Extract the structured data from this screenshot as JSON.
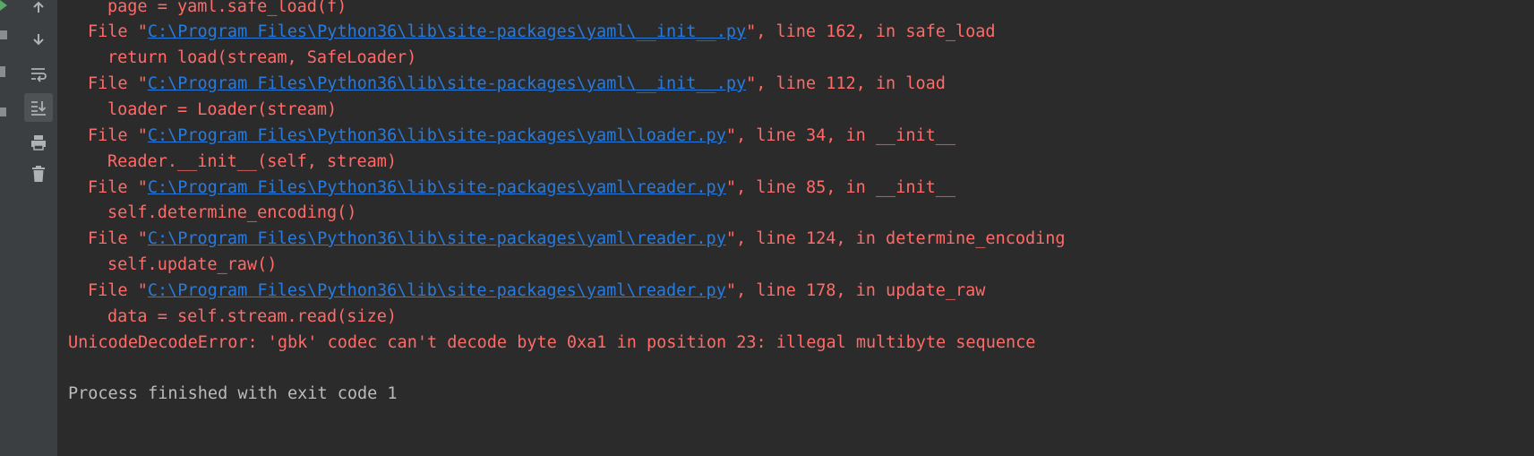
{
  "traceback": {
    "top_code": "page = yaml.safe_load(f)",
    "frames": [
      {
        "prefix": "File \"",
        "path": "C:\\Program Files\\Python36\\lib\\site-packages\\yaml\\__init__.py",
        "suffix": "\", line 162, in safe_load",
        "code": "return load(stream, SafeLoader)"
      },
      {
        "prefix": "File \"",
        "path": "C:\\Program Files\\Python36\\lib\\site-packages\\yaml\\__init__.py",
        "suffix": "\", line 112, in load",
        "code": "loader = Loader(stream)"
      },
      {
        "prefix": "File \"",
        "path": "C:\\Program Files\\Python36\\lib\\site-packages\\yaml\\loader.py",
        "suffix": "\", line 34, in __init__",
        "code": "Reader.__init__(self, stream)"
      },
      {
        "prefix": "File \"",
        "path": "C:\\Program Files\\Python36\\lib\\site-packages\\yaml\\reader.py",
        "suffix": "\", line 85, in __init__",
        "code": "self.determine_encoding()"
      },
      {
        "prefix": "File \"",
        "path": "C:\\Program Files\\Python36\\lib\\site-packages\\yaml\\reader.py",
        "suffix": "\", line 124, in determine_encoding",
        "code": "self.update_raw()"
      },
      {
        "prefix": "File \"",
        "path": "C:\\Program Files\\Python36\\lib\\site-packages\\yaml\\reader.py",
        "suffix": "\", line 178, in update_raw",
        "code": "data = self.stream.read(size)"
      }
    ],
    "error": "UnicodeDecodeError: 'gbk' codec can't decode byte 0xa1 in position 23: illegal multibyte sequence"
  },
  "process_exit": "Process finished with exit code 1",
  "toolbar_icons": [
    "arrow-up-icon",
    "arrow-down-icon",
    "soft-wrap-icon",
    "scroll-to-end-icon",
    "print-icon",
    "trash-icon"
  ],
  "colors": {
    "background": "#2b2b2b",
    "toolbar": "#3c3f41",
    "error_text": "#ff6b68",
    "link": "#287bde",
    "plain_text": "#bbbbbb",
    "run_indicator": "#59a869"
  }
}
